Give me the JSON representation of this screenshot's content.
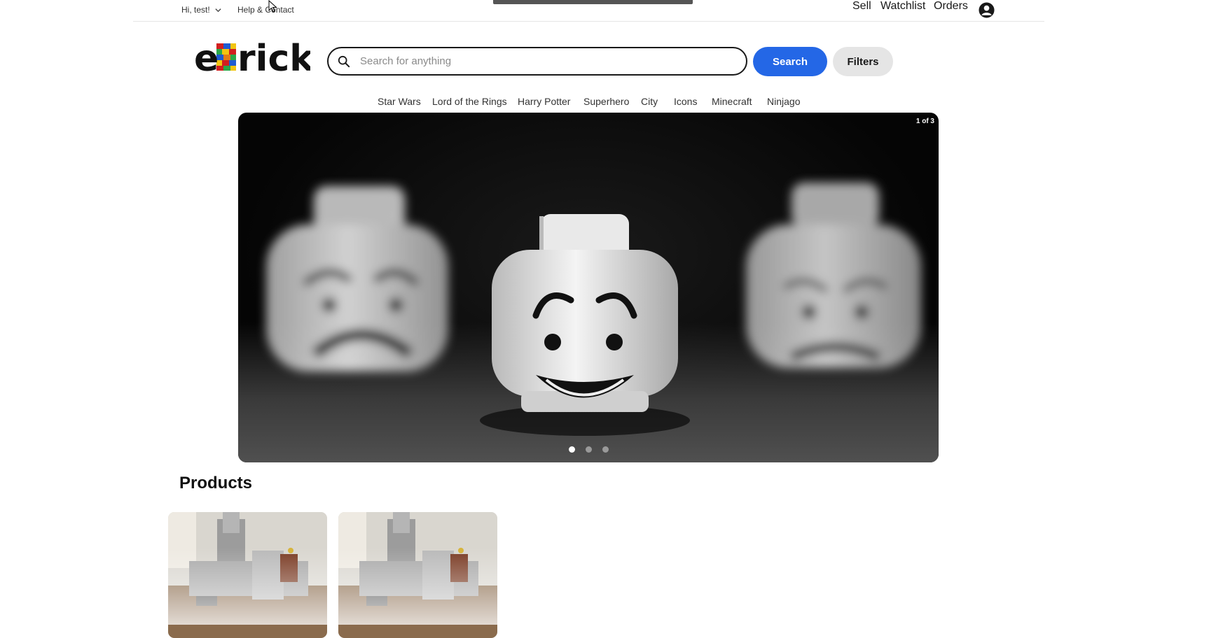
{
  "header": {
    "greeting": "Hi, test!",
    "help_link": "Help & Contact",
    "links": [
      "Sell",
      "Watchlist",
      "Orders"
    ],
    "account_icon": "user-circle-icon"
  },
  "brand": {
    "logo_text": "eBrick"
  },
  "search": {
    "placeholder": "Search for anything",
    "value": "",
    "search_label": "Search",
    "filters_label": "Filters"
  },
  "categories": [
    "Star Wars",
    "Lord of the Rings",
    "Harry Potter",
    "Superhero",
    "City",
    "Icons",
    "Minecraft",
    "Ninjago"
  ],
  "carousel": {
    "counter": "1 of 3",
    "slides": 3,
    "active_slide": 1
  },
  "products": {
    "heading": "Products",
    "items": [
      {
        "image": "castle-lego-set"
      },
      {
        "image": "castle-lego-set"
      }
    ]
  },
  "colors": {
    "accent": "#2467e6",
    "filters_bg": "#e5e5e5",
    "text": "#191919"
  }
}
